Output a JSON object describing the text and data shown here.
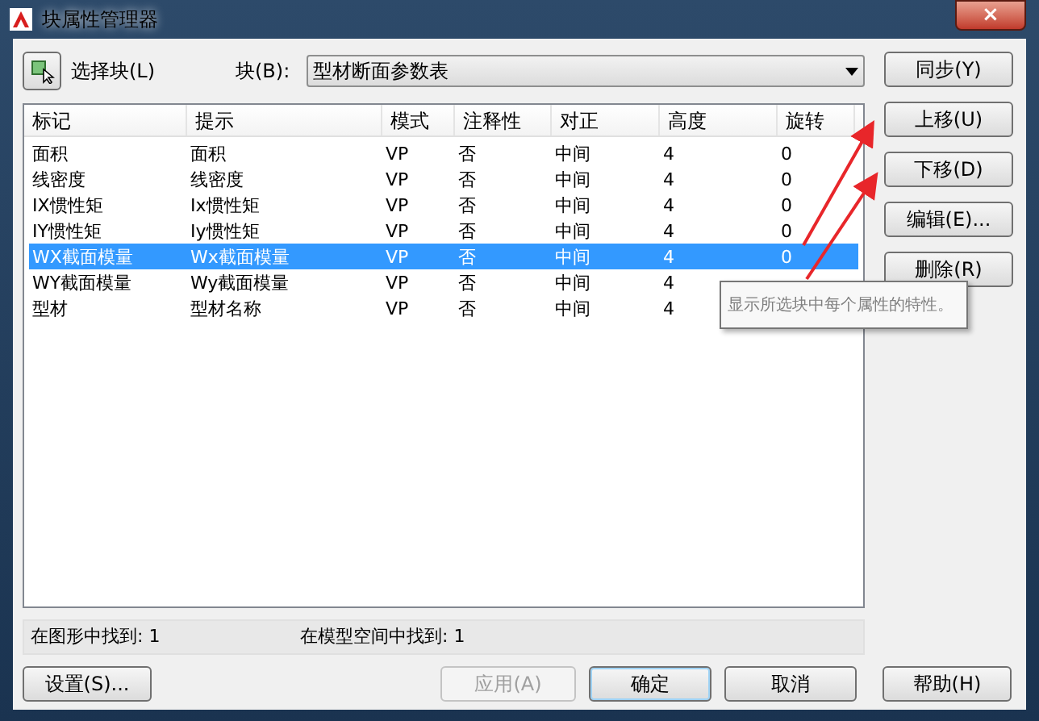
{
  "window": {
    "title": "块属性管理器",
    "close": "×"
  },
  "select_block": {
    "label": "选择块(L)"
  },
  "block": {
    "label": "块(B):",
    "value": "型材断面参数表"
  },
  "table": {
    "columns": [
      "标记",
      "提示",
      "模式",
      "注释性",
      "对正",
      "高度",
      "旋转"
    ],
    "rows": [
      {
        "cells": [
          "面积",
          "面积",
          "VP",
          "否",
          "中间",
          "4",
          "0"
        ],
        "selected": false
      },
      {
        "cells": [
          "线密度",
          "线密度",
          "VP",
          "否",
          "中间",
          "4",
          "0"
        ],
        "selected": false
      },
      {
        "cells": [
          "IX惯性矩",
          "Ix惯性矩",
          "VP",
          "否",
          "中间",
          "4",
          "0"
        ],
        "selected": false
      },
      {
        "cells": [
          "IY惯性矩",
          "Iy惯性矩",
          "VP",
          "否",
          "中间",
          "4",
          "0"
        ],
        "selected": false
      },
      {
        "cells": [
          "WX截面模量",
          "Wx截面模量",
          "VP",
          "否",
          "中间",
          "4",
          "0"
        ],
        "selected": true
      },
      {
        "cells": [
          "WY截面模量",
          "Wy截面模量",
          "VP",
          "否",
          "中间",
          "4"
        ],
        "selected": false
      },
      {
        "cells": [
          "型材",
          "型材名称",
          "VP",
          "否",
          "中间",
          "4"
        ],
        "selected": false
      }
    ]
  },
  "status": [
    "在图形中找到: 1",
    "在模型空间中找到: 1"
  ],
  "side_buttons": [
    "同步(Y)",
    "上移(U)",
    "下移(D)",
    "编辑(E)...",
    "删除(R)"
  ],
  "bottom_buttons": [
    {
      "label": "设置(S)...",
      "disabled": false,
      "default": false
    },
    {
      "label": "应用(A)",
      "disabled": true,
      "default": false
    },
    {
      "label": "确定",
      "disabled": false,
      "default": true
    },
    {
      "label": "取消",
      "disabled": false,
      "default": false
    },
    {
      "label": "帮助(H)",
      "disabled": false,
      "default": false
    }
  ],
  "tooltip": "显示所选块中每个属性的特性。"
}
